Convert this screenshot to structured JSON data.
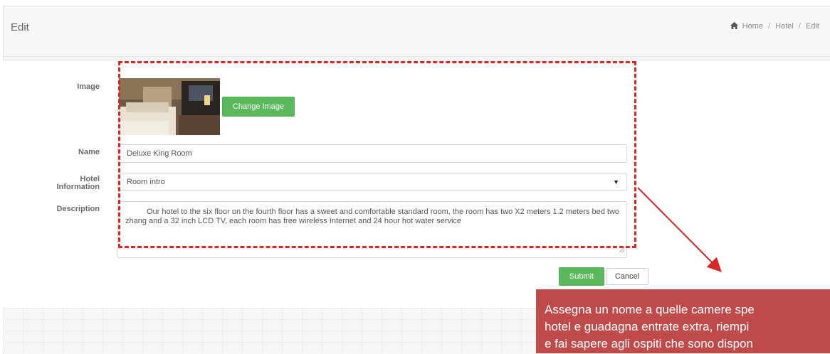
{
  "header": {
    "title": "Edit",
    "breadcrumb": [
      "Home",
      "Hotel",
      "Edit"
    ],
    "breadcrumb_separator": "/"
  },
  "form": {
    "image_label": "Image",
    "change_image_button": "Change Image",
    "name_label": "Name",
    "name_value": "Deluxe King Room",
    "hotel_info_label_line1": "Hotel",
    "hotel_info_label_line2": "Information",
    "hotel_info_selected": "Room intro",
    "description_label": "Description",
    "description_value": "Our hotel to the six floor on the fourth floor has a sweet and comfortable standard room, the room has two X2 meters 1.2 meters bed two zhang and a 32 inch LCD TV, each room has free wireless Internet and 24 hour hot water service",
    "submit_button": "Submit",
    "cancel_button": "Cancel"
  },
  "annotation": {
    "line1": "Assegna un nome a quelle camere spe",
    "line2": "hotel e guadagna entrate extra, riempi",
    "line3": "e fai sapere agli ospiti che sono dispon",
    "box_color": "#d42a2a",
    "callout_color": "#bf4a4a"
  },
  "colors": {
    "accent_green": "#5cb85c",
    "panel_bg": "#f7f7f7"
  },
  "icons": {
    "home": "home-icon",
    "select_caret": "caret-down-icon",
    "resize": "resize-grip-icon"
  }
}
